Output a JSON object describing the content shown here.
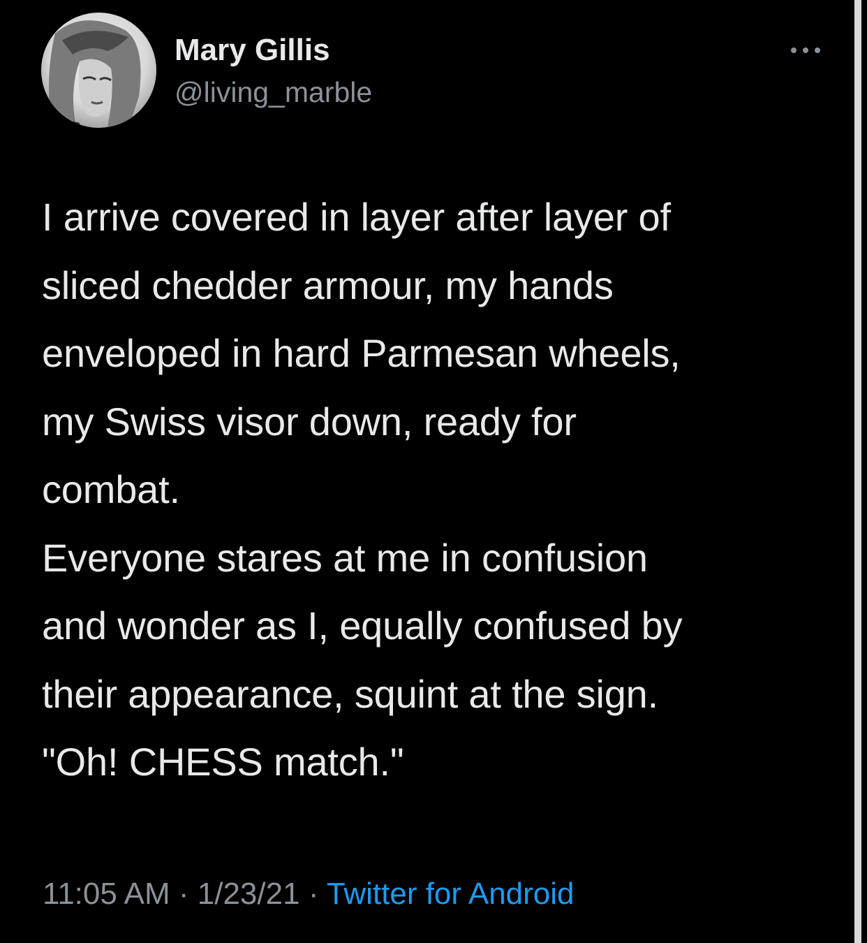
{
  "author": {
    "name": "Mary Gillis",
    "handle": "@living_marble",
    "avatar_icon": "profile-photo"
  },
  "more_icon": "more-horizontal-icon",
  "tweet": {
    "paragraphs": [
      {
        "lines": [
          "I arrive covered in layer after layer of",
          "sliced chedder armour, my hands",
          "enveloped in hard Parmesan wheels,",
          "my Swiss visor down, ready for",
          "combat."
        ]
      },
      {
        "lines": [
          "Everyone stares at me in confusion",
          "and wonder as I, equally confused by",
          "their appearance, squint at the sign."
        ]
      },
      {
        "lines": [
          "\"Oh! CHESS match.\""
        ]
      }
    ]
  },
  "meta": {
    "time": "11:05 AM",
    "separator": "·",
    "date": "1/23/21",
    "source": "Twitter for Android"
  },
  "colors": {
    "background": "#000000",
    "text": "#e7e9ea",
    "secondary": "#8b9198",
    "link": "#1d9bf0"
  }
}
